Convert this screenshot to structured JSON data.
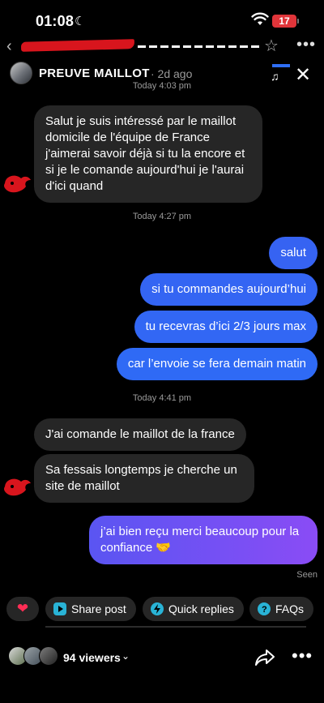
{
  "status_bar": {
    "time": "01:08",
    "battery": "17"
  },
  "header": {
    "title": "PREUVE MAILLOT",
    "ago": "· 2d ago",
    "posted_time": "Today 4:03 pm"
  },
  "thread": {
    "incoming_1": "Salut je suis intéressé par le maillot domicile de l'équipe de France j'aimerai savoir déjà si tu la encore et si je le comande aujourd'hui je l'aurai d'ici quand",
    "time_2": "Today 4:27 pm",
    "outgoing_1": "salut",
    "outgoing_2": "si tu commandes aujourd’hui",
    "outgoing_3": "tu recevras d’ici 2/3 jours max",
    "outgoing_4": "car l’envoie se fera demain matin",
    "time_3": "Today 4:41 pm",
    "incoming_2": "J'ai comande le maillot de la france",
    "incoming_3": "Sa fessais longtemps je cherche un site de maillot",
    "outgoing_5": "j’ai bien reçu merci beaucoup pour la confiance 🤝",
    "seen": "Seen"
  },
  "quick_actions": {
    "share": "Share post",
    "quick": "Quick replies",
    "faqs": "FAQs"
  },
  "footer": {
    "viewers": "94 viewers"
  },
  "colors": {
    "outgoing_blue": "#2f6ef5",
    "outgoing_purple": "#7a4df5",
    "incoming": "#262626"
  },
  "icons": [
    "moon-icon",
    "wifi-icon",
    "battery-icon",
    "back-icon",
    "star-icon",
    "more-icon",
    "music-icon",
    "close-icon",
    "heart-icon",
    "share-post-icon",
    "quick-replies-icon",
    "faqs-icon",
    "chevron-down-icon",
    "share-icon"
  ]
}
